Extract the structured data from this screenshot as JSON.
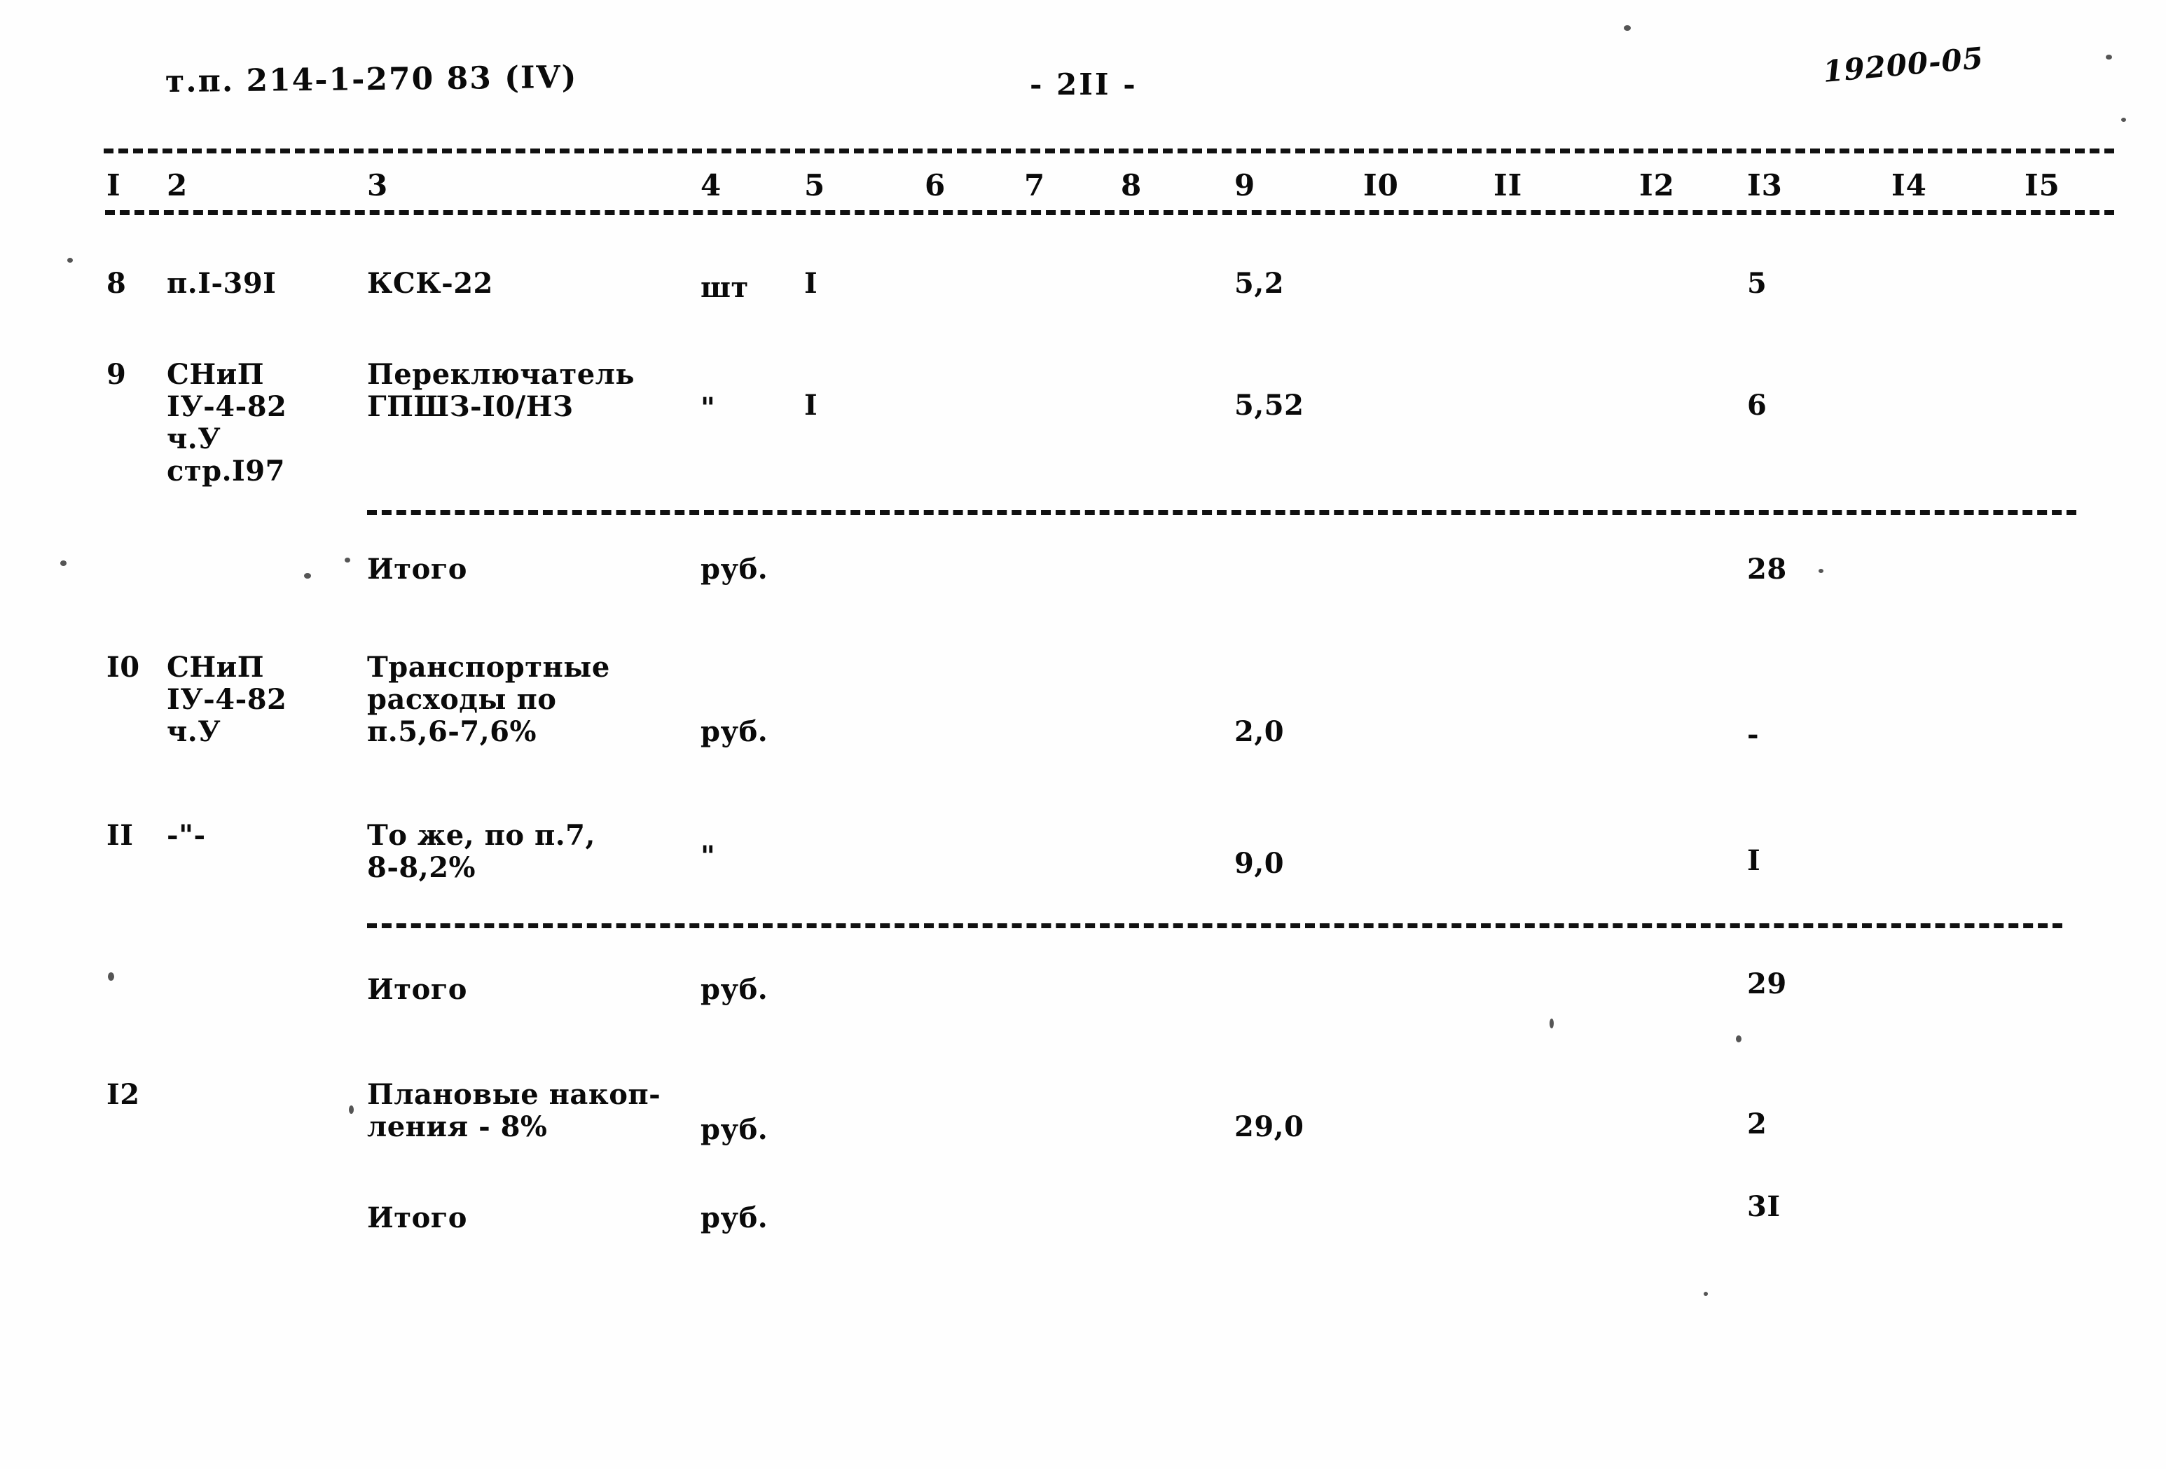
{
  "header": {
    "doc_code": "т.п. 214-1-270 83 (IV)",
    "page_number": "- 2II -",
    "stamp": "19200-05"
  },
  "table": {
    "column_numbers": [
      "I",
      "2",
      "3",
      "4",
      "5",
      "6",
      "7",
      "8",
      "9",
      "I0",
      "II",
      "I2",
      "I3",
      "I4",
      "I5"
    ],
    "rows": [
      {
        "c1": "8",
        "c2": "п.I-39I",
        "c3": "КСК-22",
        "c4": "шт",
        "c5": "I",
        "c9": "5,2",
        "c13": "5"
      },
      {
        "c1": "9",
        "c2": "СНиП\nIУ-4-82\nч.У\nстр.I97",
        "c3": "Переключатель\nГПШЗ-I0/НЗ",
        "c4": "\"",
        "c5": "I",
        "c9": "5,52",
        "c13": "6"
      },
      {
        "c1": "",
        "c2": "",
        "c3": "Итого",
        "c4": "руб.",
        "c5": "",
        "c9": "",
        "c13": "28"
      },
      {
        "c1": "I0",
        "c2": "СНиП\nIУ-4-82\nч.У",
        "c3": "Транспортные\nрасходы по\nп.5,6-7,6%",
        "c4": "руб.",
        "c5": "",
        "c9": "2,0",
        "c13": "-"
      },
      {
        "c1": "II",
        "c2": "-\"-",
        "c3": "То же, по п.7,\n8-8,2%",
        "c4": "\"",
        "c5": "",
        "c9": "9,0",
        "c13": "I"
      },
      {
        "c1": "",
        "c2": "",
        "c3": "Итого",
        "c4": "руб.",
        "c5": "",
        "c9": "",
        "c13": "29"
      },
      {
        "c1": "I2",
        "c2": "",
        "c3": "Плановые накоп-\nления - 8%",
        "c4": "руб.",
        "c5": "",
        "c9": "29,0",
        "c13": "2"
      },
      {
        "c1": "",
        "c2": "",
        "c3": "Итого",
        "c4": "руб.",
        "c5": "",
        "c9": "",
        "c13": "3I"
      }
    ]
  }
}
